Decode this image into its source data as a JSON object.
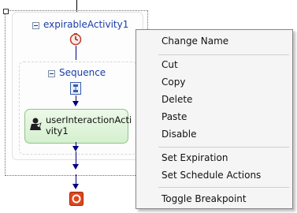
{
  "designer": {
    "expirable_title": "expirableActivity1",
    "sequence_title": "Sequence",
    "activity_label_line1": "userInteractionActi",
    "activity_label_line2": "vity1"
  },
  "context_menu": {
    "items": [
      {
        "label": "Change Name"
      },
      {
        "label": "Cut"
      },
      {
        "label": "Copy"
      },
      {
        "label": "Delete"
      },
      {
        "label": "Paste"
      },
      {
        "label": "Disable"
      },
      {
        "label": "Set Expiration"
      },
      {
        "label": "Set Schedule Actions"
      },
      {
        "label": "Toggle Breakpoint"
      }
    ]
  },
  "icons": {
    "timer": "clock-icon",
    "sequence": "sequence-icon",
    "activity": "user-interaction-icon",
    "end": "stop-icon"
  },
  "colors": {
    "connector": "#000080",
    "title": "#1a3da8",
    "activity_fill": "#d5efcf",
    "end_icon": "#e0461c"
  }
}
